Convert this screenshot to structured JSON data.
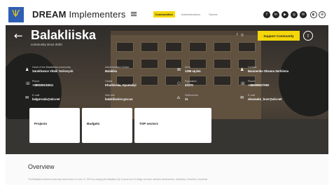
{
  "header": {
    "logo_glyph": "Ѱ",
    "brand_bold": "DREAM",
    "brand_rest": " Implementers",
    "burger_glyph": "≡",
    "nav": [
      {
        "label": "Communities",
        "active": true
      },
      {
        "label": "Administrations",
        "active": false
      },
      {
        "label": "Stories",
        "active": false
      }
    ],
    "socials": [
      "f",
      "in",
      "▶",
      "◎",
      "✉"
    ],
    "accessibility": [
      "◐",
      "⊕"
    ]
  },
  "hero": {
    "back_glyph": "←",
    "title": "Balakliiska",
    "since": "community since 2020",
    "support_label": "Support Community",
    "share_glyph": "⇪",
    "mini_icons": [
      "f",
      "◎"
    ],
    "info": [
      {
        "label": "Head of the Balakliiska community",
        "value": "Sarukhanov Vitalii Yuriiovych",
        "icon": "♟"
      },
      {
        "label": "Administrative Center",
        "value": "Balakliia",
        "icon": ""
      },
      {
        "label": "Area",
        "value": "1296 sq.km",
        "icon": "⊞"
      },
      {
        "label": "Contact",
        "value": "Baranenko Oksana Serhiivna",
        "icon": "♟"
      },
      {
        "label": "Phone",
        "value": "+380509103611",
        "icon": "☏"
      },
      {
        "label": "Oblast",
        "value": "Kharkivska, Izyumskyi",
        "icon": ""
      },
      {
        "label": "Population",
        "value": "41070",
        "icon": "⚇"
      },
      {
        "label": "Phone",
        "value": "+380999627692",
        "icon": "☏"
      },
      {
        "label": "E-mail",
        "value": "balgorrada@ukr.net",
        "icon": "✉"
      },
      {
        "label": "Web site",
        "value": "balakliiamisr.gov.ua",
        "icon": ""
      },
      {
        "label": "Settlements",
        "value": "11",
        "icon": "⌂"
      },
      {
        "label": "E-mail",
        "value": "oksanako_bnsr@ukr.net",
        "icon": "✉"
      }
    ],
    "cards": [
      "Projects",
      "Budgets",
      "TOP sectors"
    ]
  },
  "overview": {
    "title": "Overview",
    "text": "The Balakliia territorial community was formed on June 12, 2020 by merging the Balakliia City Council and 14 village councils: Ivanivka, Borshchivka, Shpakivka, Veselivka, Yavorivka"
  },
  "colors": {
    "accent": "#f5d60a",
    "brand_blue": "#2f5fb3",
    "text_dark": "#222222"
  }
}
